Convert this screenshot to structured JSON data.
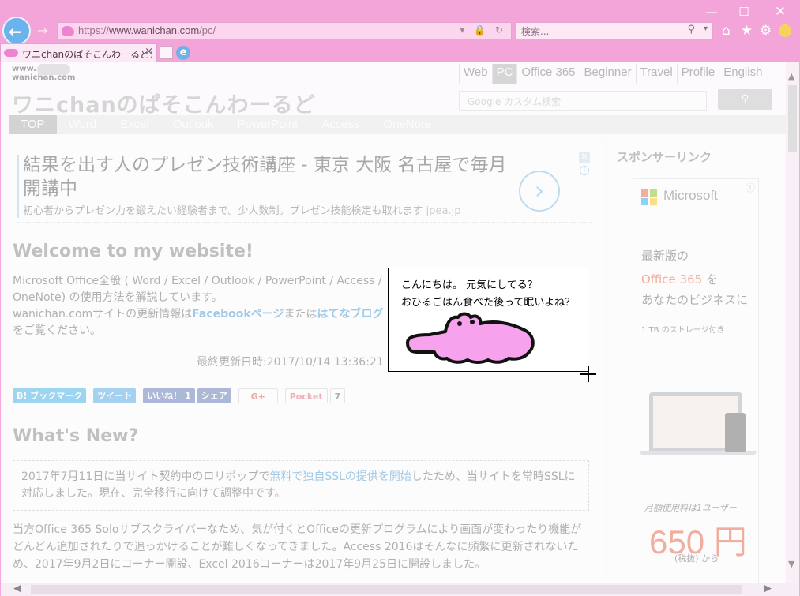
{
  "window": {
    "minimize": "—",
    "maximize": "☐",
    "close": "✕"
  },
  "nav": {
    "url_scheme": "https://",
    "url_host": "www.wanichan.com",
    "url_path": "/pc/",
    "search_placeholder": "検索..."
  },
  "tab": {
    "title": "ワニchanのぱそこんわーるど：..."
  },
  "page": {
    "logo_small_1": "www.",
    "logo_small_2": "wanichan.com",
    "logo": "ワニchanのぱそこんわーるど",
    "lang_nav": [
      "Web",
      "PC",
      "Office 365",
      "Beginner",
      "Travel",
      "Profile",
      "English"
    ],
    "search_placeholder": "Google カスタム検索",
    "categories": [
      "TOP",
      "Word",
      "Excel",
      "Outlook",
      "PowerPoint",
      "Access",
      "OneNote"
    ],
    "ad": {
      "title": "結果を出す人のプレゼン技術講座 - 東京 大阪 名古屋で毎月開講中",
      "desc": "初心者からプレゼン力を鍛えたい経験者まで。少人数制。プレゼン技能検定も取れます",
      "source": "jpea.jp"
    },
    "welcome": {
      "heading": "Welcome to my website!",
      "line1": "Microsoft Office全般 ( Word / Excel / Outlook / PowerPoint / Access /",
      "line2": "OneNote) の使用方法を解説しています。",
      "line3_a": "wanichan.comサイトの更新情報は",
      "link_facebook": "Facebookページ",
      "line3_b": "または",
      "link_hatena": "はてなブログ",
      "line4": "をご覧ください。",
      "updated": "最終更新日時:2017/10/14 13:36:21"
    },
    "share": {
      "hatena": "B! ブックマーク",
      "tweet": "ツイート",
      "like": "いいね！ 1",
      "share": "シェア",
      "gplus": "G+",
      "pocket": "Pocket",
      "pocket_count": "7"
    },
    "whatsnew": {
      "heading": "What's New?",
      "notice_a": "2017年7月11日に当サイト契約中のロリポップで",
      "notice_link": "無料で独自SSLの提供を開始",
      "notice_b": "したため、当サイトを常時SSLに対応しました。現在、完全移行に向けて調整中です。",
      "para": "当方Office 365 Soloサブスクライバーなため、気が付くとOfficeの更新プログラムにより画面が変わったり機能がどんどん追加されたりで追っかけることが難しくなってきました。Access 2016はそんなに頻繁に更新されないため、2017年9月2日にコーナー開設、Excel 2016コーナーは2017年9月25日に開設しました。"
    },
    "sidebar": {
      "heading": "スポンサーリンク",
      "ms_logo": "Microsoft",
      "line1": "最新版の",
      "line2_brand": "Office 365",
      "line2_rest": " を",
      "line3": "あなたのビジネスに",
      "line4": "1 TB のストレージ付き",
      "price_note": "月額使用料は1ユーザー",
      "price": "650 円",
      "tax": "(税抜) から"
    }
  },
  "popup": {
    "line1": "こんにちは。 元気にしてる？",
    "line2": "おひるごはん食べた後って眠いよね？"
  },
  "colors": {
    "chrome_pink": "#f3a5da",
    "croc_pink": "#f7a2ec",
    "link_blue": "#2f8fcf",
    "office_orange": "#e3522b"
  }
}
